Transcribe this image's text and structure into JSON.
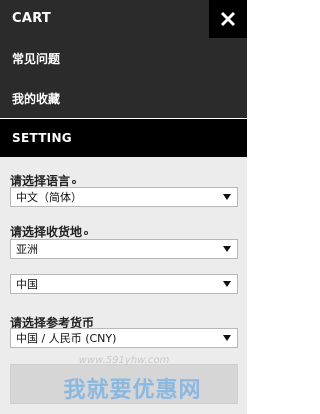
{
  "header": {
    "title": "CART"
  },
  "nav": {
    "items": [
      {
        "label": "常见问题"
      },
      {
        "label": "我的收藏"
      }
    ]
  },
  "setting": {
    "title": "SETTING"
  },
  "language": {
    "label": "请选择语言",
    "value": "中文（简体）"
  },
  "region": {
    "label": "请选择收货地",
    "continent": "亚洲",
    "country": "中国"
  },
  "currency": {
    "label": "请选择参考货币",
    "value": "中国 / 人民币 (CNY)"
  },
  "watermark": {
    "url": "www.591yhw.com",
    "text": "我就要优惠网"
  }
}
